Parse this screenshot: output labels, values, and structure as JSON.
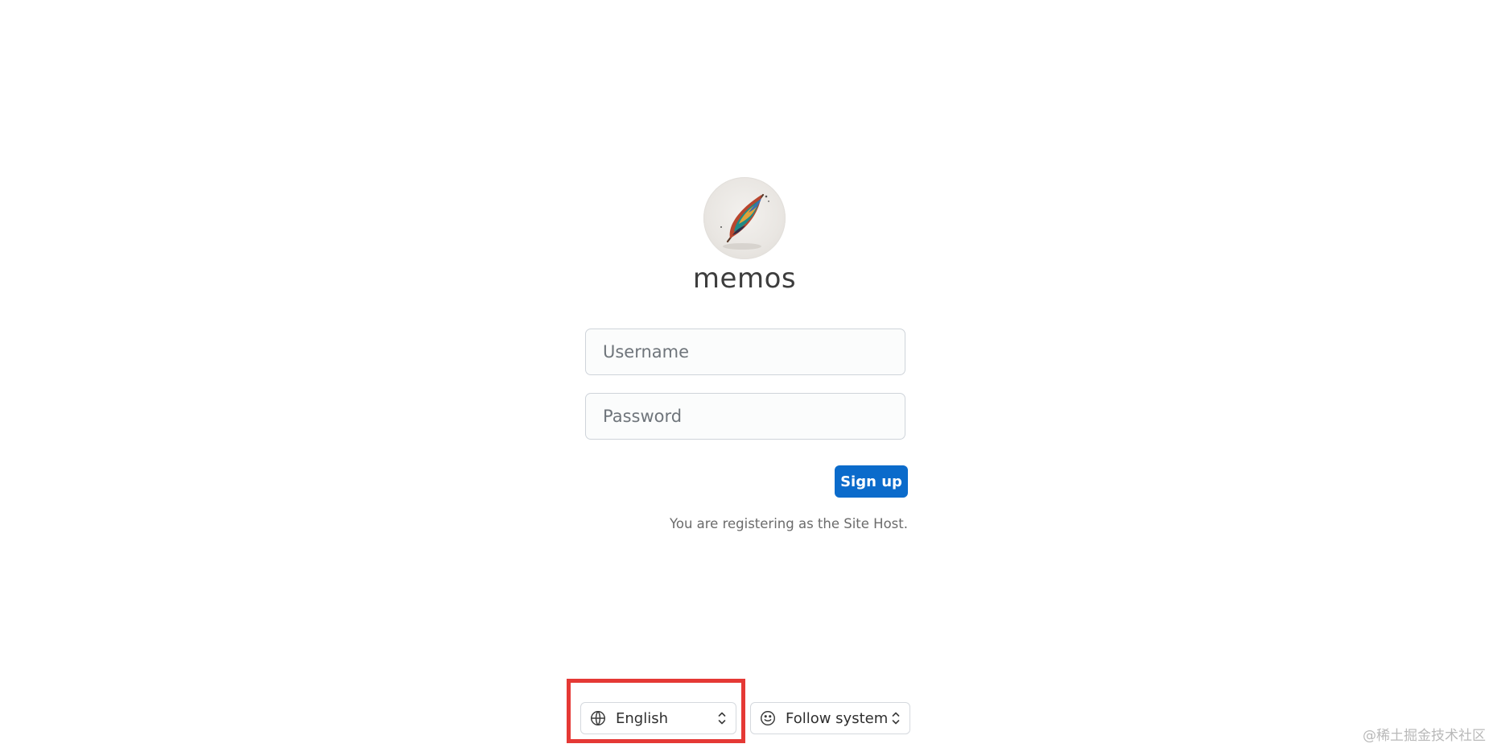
{
  "brand": {
    "name": "memos",
    "logo_icon": "feather-quill-icon"
  },
  "form": {
    "username_placeholder": "Username",
    "password_placeholder": "Password",
    "signup_label": "Sign up",
    "host_hint": "You are registering as the Site Host."
  },
  "footer": {
    "language_icon": "globe-icon",
    "language_value": "English",
    "appearance_icon": "smile-icon",
    "appearance_value": "Follow system",
    "chevron_icon": "chevron-up-down-icon"
  },
  "watermark": "@稀土掘金技术社区",
  "colors": {
    "primary": "#0b6bcb",
    "annotation": "#e53935",
    "background": "#ffffff"
  }
}
